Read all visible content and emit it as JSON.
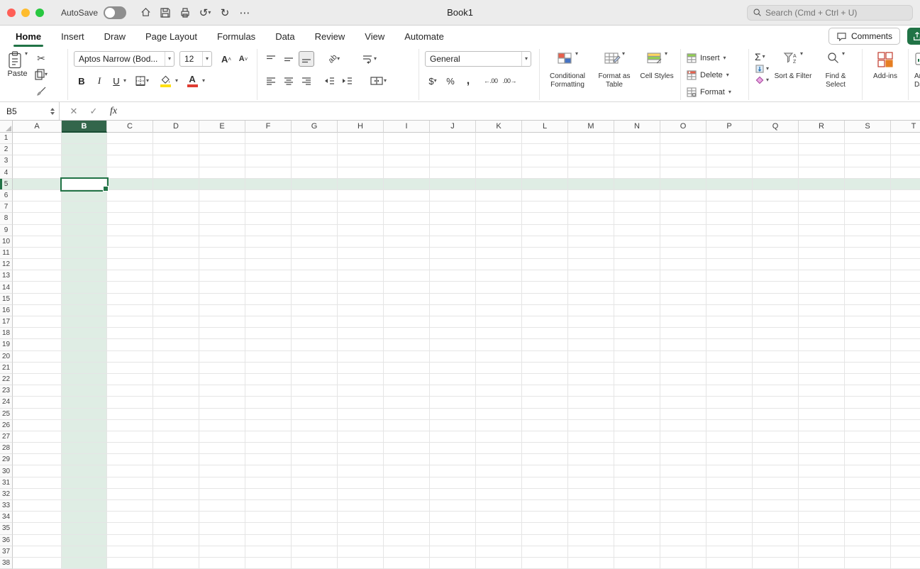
{
  "titlebar": {
    "title": "Book1",
    "autosave_label": "AutoSave",
    "autosave_on": false,
    "search_placeholder": "Search (Cmd + Ctrl + U)"
  },
  "tabbar": {
    "tabs": [
      {
        "label": "Home",
        "active": true
      },
      {
        "label": "Insert",
        "active": false
      },
      {
        "label": "Draw",
        "active": false
      },
      {
        "label": "Page Layout",
        "active": false
      },
      {
        "label": "Formulas",
        "active": false
      },
      {
        "label": "Data",
        "active": false
      },
      {
        "label": "Review",
        "active": false
      },
      {
        "label": "View",
        "active": false
      },
      {
        "label": "Automate",
        "active": false
      }
    ],
    "comments_label": "Comments"
  },
  "ribbon": {
    "paste_label": "Paste",
    "font_name": "Aptos Narrow (Bod...",
    "font_size": "12",
    "bold": "B",
    "italic": "I",
    "underline": "U",
    "increase_font": "A",
    "decrease_font": "A",
    "orientation_text": "ab",
    "number_format": "General",
    "currency": "$",
    "percent": "%",
    "comma": ",",
    "increase_decimal": "←.00",
    "decrease_decimal": ".00→",
    "styles": [
      {
        "label": "Conditional Formatting"
      },
      {
        "label": "Format as Table"
      },
      {
        "label": "Cell Styles"
      }
    ],
    "cells": [
      {
        "label": "Insert"
      },
      {
        "label": "Delete"
      },
      {
        "label": "Format"
      }
    ],
    "editing": {
      "autosum": "Σ",
      "sort_filter_label": "Sort & Filter",
      "find_select_label": "Find & Select"
    },
    "addins_label": "Add-ins",
    "analyze_label_line1": "Ana",
    "analyze_label_line2": "Da"
  },
  "formula_bar": {
    "name_box": "B5",
    "fx_label": "fx",
    "formula_value": ""
  },
  "grid": {
    "columns": [
      "A",
      "B",
      "C",
      "D",
      "E",
      "F",
      "G",
      "H",
      "I",
      "J",
      "K",
      "L",
      "M",
      "N",
      "O",
      "P",
      "Q",
      "R",
      "S",
      "T"
    ],
    "row_count": 38,
    "selected_cell": "B5",
    "selected_column": "B",
    "selected_row": 5
  },
  "colors": {
    "accent_green": "#217346",
    "selection_fill": "#DFEDE4",
    "selected_header_bg": "#33664B",
    "fill_color_swatch": "#FFE014",
    "font_color_swatch": "#E03C32",
    "titlebar_bg": "#ECECEC"
  }
}
